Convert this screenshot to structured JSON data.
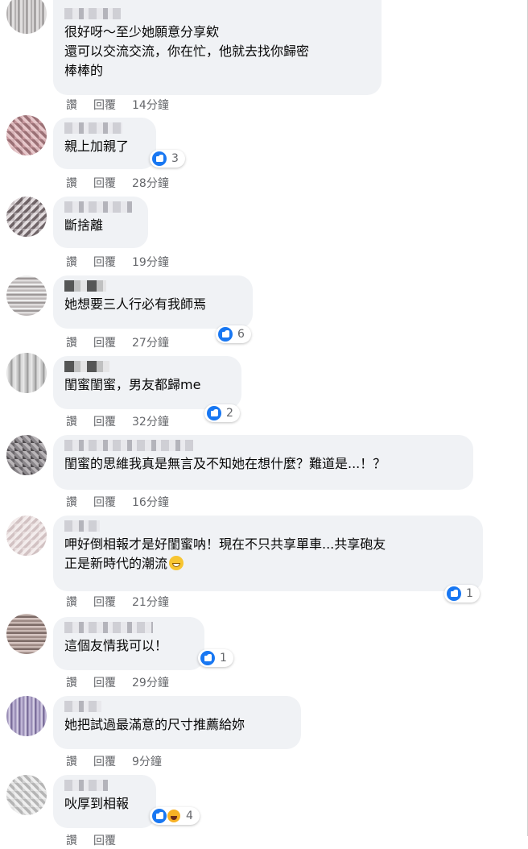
{
  "actions": {
    "like_label": "讚",
    "reply_label": "回覆"
  },
  "comments": [
    {
      "text": "很好呀～至少她願意分享欸\n還可以交流交流，你在忙，他就去找你歸密\n棒棒的",
      "time": "14分鐘",
      "reaction_count": ""
    },
    {
      "text": "親上加親了",
      "time": "28分鐘",
      "reaction_count": "3"
    },
    {
      "text": "斷捨離",
      "time": "19分鐘",
      "reaction_count": ""
    },
    {
      "text": "她想要三人行必有我師焉",
      "time": "27分鐘",
      "reaction_count": "6"
    },
    {
      "text": "閨蜜閨蜜，男友都歸me",
      "time": "32分鐘",
      "reaction_count": "2"
    },
    {
      "text": "閨蜜的思維我真是無言及不知她在想什麼？難道是...！？",
      "time": "16分鐘",
      "reaction_count": ""
    },
    {
      "text": "呷好倒相報才是好閨蜜呐！現在不只共享單車...共享砲友\n正是新時代的潮流",
      "time": "21分鐘",
      "reaction_count": "1"
    },
    {
      "text": "這個友情我可以！",
      "time": "29分鐘",
      "reaction_count": "1"
    },
    {
      "text": "她把試過最滿意的尺寸推薦給妳",
      "time": "9分鐘",
      "reaction_count": ""
    },
    {
      "text": "吙厚到相報",
      "time": "",
      "reaction_count": "4"
    }
  ],
  "colors": {
    "bubble": "#f0f2f5",
    "meta_text": "#65676b",
    "like_blue": "#1877f2",
    "haha_yellow": "#f7b125"
  },
  "icons": {
    "like": "like-icon",
    "haha": "haha-icon",
    "grin": "grinning-emoji-icon"
  }
}
